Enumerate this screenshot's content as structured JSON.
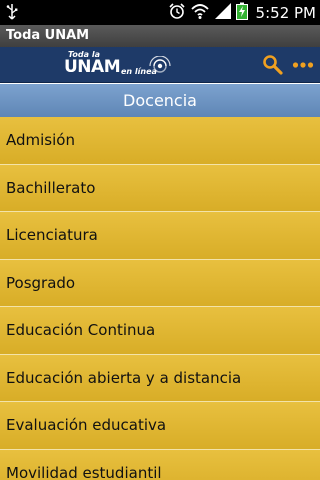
{
  "status_bar": {
    "time": "5:52 PM",
    "icons": [
      "usb-icon",
      "alarm-icon",
      "wifi-icon",
      "signal-icon",
      "battery-charging-icon"
    ]
  },
  "title_bar": {
    "title": "Toda UNAM"
  },
  "header": {
    "logo": {
      "top_text": "Toda la",
      "main_text": "UNAM",
      "sub_text": "en línea"
    },
    "icons": [
      "search-icon",
      "more-icon"
    ],
    "colors": {
      "background": "#1e3a68",
      "accent": "#f0a020"
    }
  },
  "section": {
    "title": "Docencia"
  },
  "menu": {
    "items": [
      {
        "label": "Admisión"
      },
      {
        "label": "Bachillerato"
      },
      {
        "label": "Licenciatura"
      },
      {
        "label": "Posgrado"
      },
      {
        "label": "Educación Continua"
      },
      {
        "label": "Educación abierta y a distancia"
      },
      {
        "label": "Evaluación educativa"
      },
      {
        "label": "Movilidad estudiantil"
      }
    ],
    "colors": {
      "item_background": "#e0b532"
    }
  }
}
